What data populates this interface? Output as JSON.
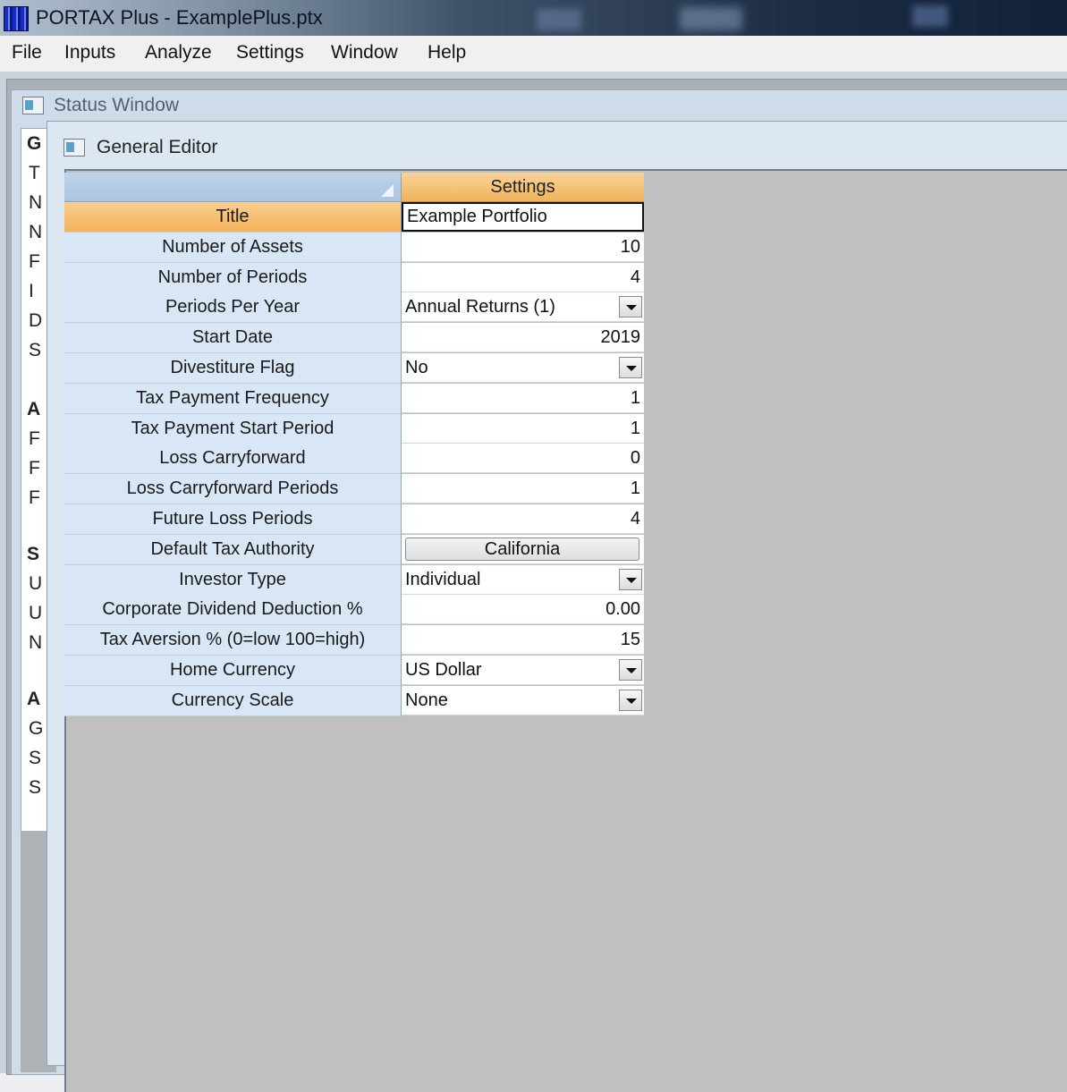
{
  "app": {
    "title": "PORTAX Plus - ExamplePlus.ptx"
  },
  "menu": [
    "File",
    "Inputs",
    "Analyze",
    "Settings",
    "Window",
    "Help"
  ],
  "status_window": {
    "title": "Status Window",
    "letters": [
      {
        "t": "G",
        "h": true
      },
      {
        "t": "T"
      },
      {
        "t": "N"
      },
      {
        "t": "N"
      },
      {
        "t": "F"
      },
      {
        "t": "I"
      },
      {
        "t": "D"
      },
      {
        "t": "S"
      },
      {
        "t": "A",
        "h": true
      },
      {
        "t": "F"
      },
      {
        "t": "F"
      },
      {
        "t": "F"
      },
      {
        "t": "S",
        "h": true
      },
      {
        "t": "U"
      },
      {
        "t": "U"
      },
      {
        "t": "N"
      },
      {
        "t": "A",
        "h": true
      },
      {
        "t": "G"
      },
      {
        "t": "S"
      },
      {
        "t": "S"
      }
    ]
  },
  "general_editor": {
    "title": "General Editor",
    "column_header": "Settings",
    "rows": [
      {
        "label": "Title",
        "value": "Example Portfolio",
        "kind": "edit",
        "selected": true
      },
      {
        "label": "Number of Assets",
        "value": "10",
        "kind": "num"
      },
      {
        "label": "Number of Periods",
        "value": "4",
        "kind": "num"
      },
      {
        "label": "Periods Per Year",
        "value": "Annual Returns  (1)",
        "kind": "dropdown"
      },
      {
        "label": "Start Date",
        "value": "2019",
        "kind": "num"
      },
      {
        "label": "Divestiture Flag",
        "value": "No",
        "kind": "dropdown"
      },
      {
        "label": "Tax Payment Frequency",
        "value": "1",
        "kind": "num"
      },
      {
        "label": "Tax Payment Start Period",
        "value": "1",
        "kind": "num"
      },
      {
        "label": "Loss Carryforward",
        "value": "0",
        "kind": "num"
      },
      {
        "label": "Loss Carryforward Periods",
        "value": "1",
        "kind": "num"
      },
      {
        "label": "Future Loss Periods",
        "value": "4",
        "kind": "num"
      },
      {
        "label": "Default Tax Authority",
        "value": "California",
        "kind": "button"
      },
      {
        "label": "Investor Type",
        "value": "Individual",
        "kind": "dropdown"
      },
      {
        "label": "Corporate Dividend Deduction %",
        "value": "0.00",
        "kind": "num"
      },
      {
        "label": "Tax Aversion % (0=low 100=high)",
        "value": "15",
        "kind": "num"
      },
      {
        "label": "Home Currency",
        "value": "US Dollar",
        "kind": "dropdown"
      },
      {
        "label": "Currency Scale",
        "value": "None",
        "kind": "dropdown"
      }
    ]
  }
}
